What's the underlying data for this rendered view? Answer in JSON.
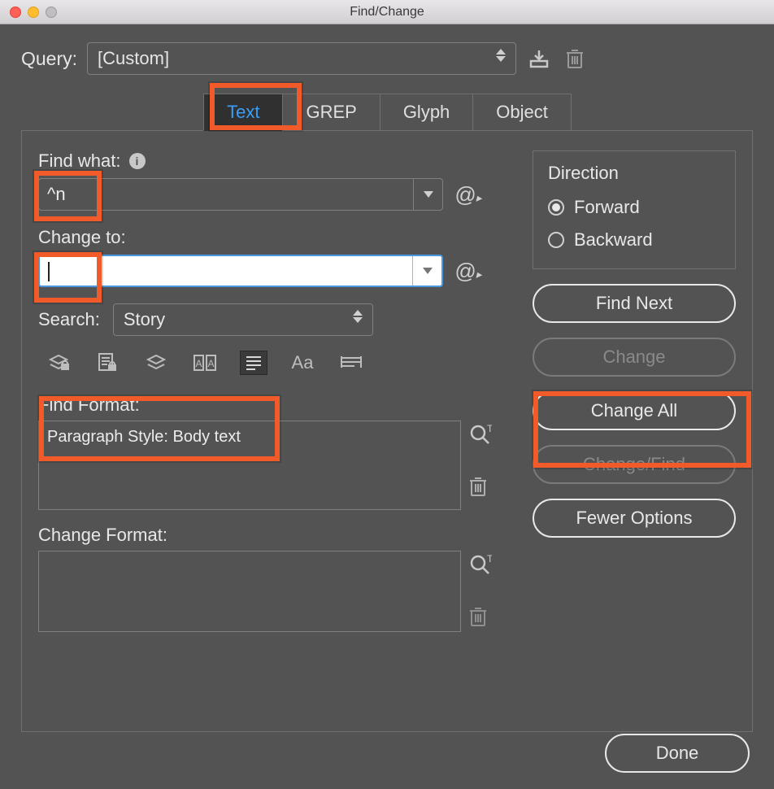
{
  "window": {
    "title": "Find/Change"
  },
  "query": {
    "label": "Query:",
    "value": "[Custom]"
  },
  "tabs": [
    {
      "label": "Text",
      "active": true
    },
    {
      "label": "GREP",
      "active": false
    },
    {
      "label": "Glyph",
      "active": false
    },
    {
      "label": "Object",
      "active": false
    }
  ],
  "find_what": {
    "label": "Find what:",
    "value": "^n"
  },
  "change_to": {
    "label": "Change to:",
    "value": ""
  },
  "search": {
    "label": "Search:",
    "value": "Story"
  },
  "find_format": {
    "label": "Find Format:",
    "value": "Paragraph Style: Body text"
  },
  "change_format": {
    "label": "Change Format:",
    "value": ""
  },
  "direction": {
    "title": "Direction",
    "forward": "Forward",
    "backward": "Backward",
    "selected": "forward"
  },
  "buttons": {
    "find_next": "Find Next",
    "change": "Change",
    "change_all": "Change All",
    "change_find": "Change/Find",
    "fewer_options": "Fewer Options",
    "done": "Done"
  },
  "icons": {
    "save_query": "save-query-icon",
    "delete_query": "trash-icon",
    "info": "info-icon",
    "special_chars": "@",
    "locked_layers": "locked-layers-icon",
    "locked_stories": "locked-stories-icon",
    "hidden_layers": "hidden-layers-icon",
    "master_pages": "master-pages-icon",
    "footnotes": "footnotes-icon",
    "case_sensitive": "Aa",
    "whole_word": "whole-word-icon",
    "specify_find": "specify-format-icon",
    "clear_find": "trash-icon",
    "specify_change": "specify-format-icon",
    "clear_change": "trash-icon"
  }
}
